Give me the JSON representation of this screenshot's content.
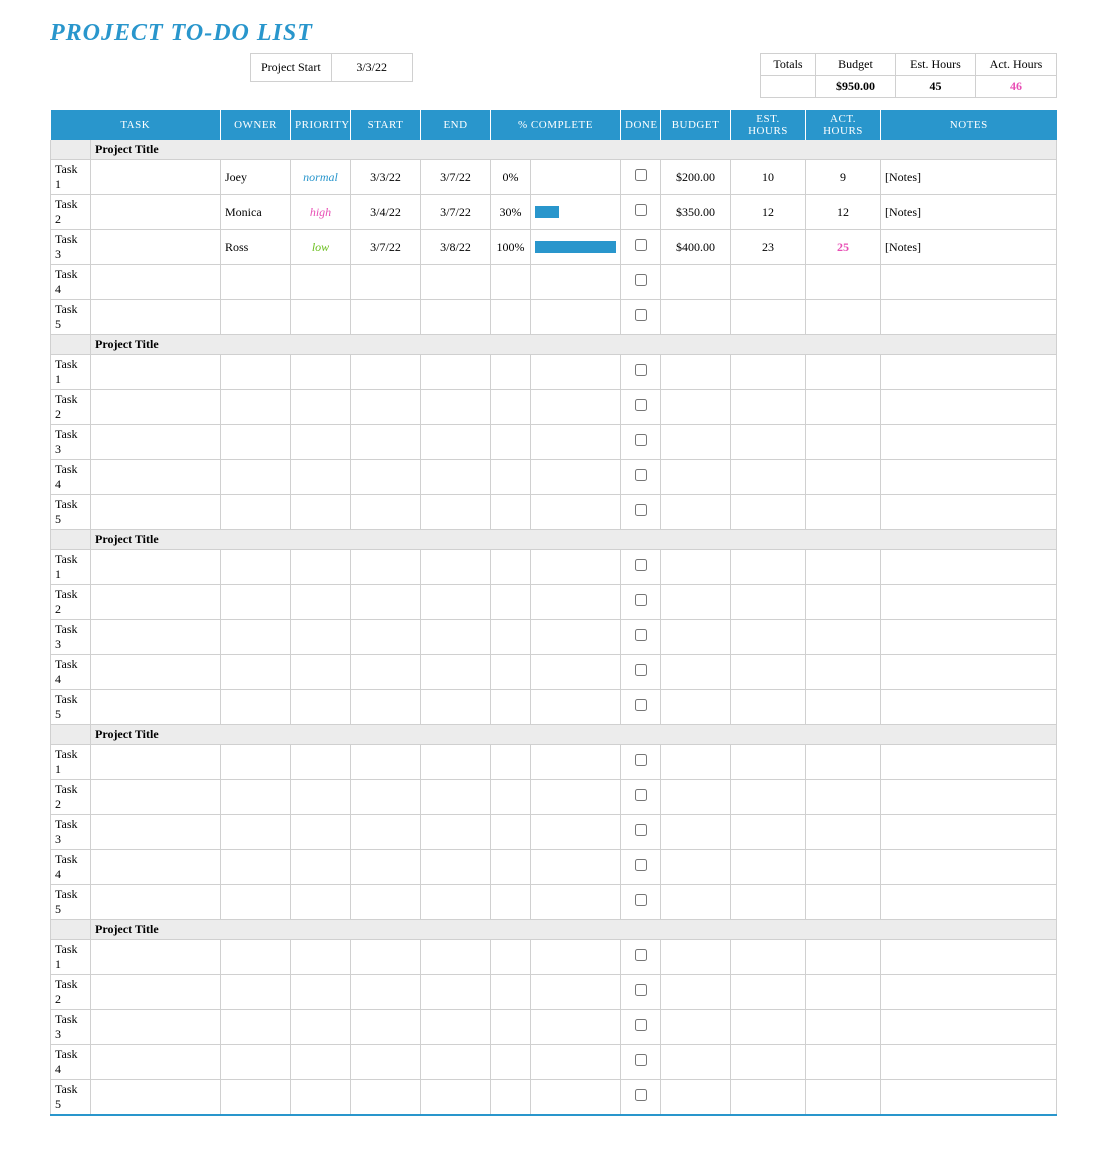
{
  "page": {
    "title": "PROJECT TO-DO LIST"
  },
  "project_start": {
    "label": "Project Start",
    "value": "3/3/22"
  },
  "totals": {
    "row_label": "Totals",
    "budget_label": "Budget",
    "budget_value": "$950.00",
    "esthrs_label": "Est. Hours",
    "esthrs_value": "45",
    "acthrs_label": "Act. Hours",
    "acthrs_value": "46"
  },
  "columns": {
    "task": "TASK",
    "owner": "OWNER",
    "priority": "PRIORITY",
    "start": "START",
    "end": "END",
    "pct": "% COMPLETE",
    "done": "DONE",
    "budget": "BUDGET",
    "esthrs": "EST. HOURS",
    "acthrs": "ACT. HOURS",
    "notes": "NOTES"
  },
  "sections": [
    {
      "title": "Project Title",
      "rows": [
        {
          "task": "Task 1",
          "owner": "Joey",
          "priority": "normal",
          "start": "3/3/22",
          "end": "3/7/22",
          "pct": "0%",
          "pct_num": 0,
          "done": false,
          "budget": "$200.00",
          "est": "10",
          "act": "9",
          "act_exceed": false,
          "notes": "[Notes]"
        },
        {
          "task": "Task 2",
          "owner": "Monica",
          "priority": "high",
          "start": "3/4/22",
          "end": "3/7/22",
          "pct": "30%",
          "pct_num": 30,
          "done": false,
          "budget": "$350.00",
          "est": "12",
          "act": "12",
          "act_exceed": false,
          "notes": "[Notes]"
        },
        {
          "task": "Task 3",
          "owner": "Ross",
          "priority": "low",
          "start": "3/7/22",
          "end": "3/8/22",
          "pct": "100%",
          "pct_num": 100,
          "done": false,
          "budget": "$400.00",
          "est": "23",
          "act": "25",
          "act_exceed": true,
          "notes": "[Notes]"
        },
        {
          "task": "Task 4"
        },
        {
          "task": "Task 5"
        }
      ]
    },
    {
      "title": "Project Title",
      "rows": [
        {
          "task": "Task 1"
        },
        {
          "task": "Task 2"
        },
        {
          "task": "Task 3"
        },
        {
          "task": "Task 4"
        },
        {
          "task": "Task 5"
        }
      ]
    },
    {
      "title": "Project Title",
      "rows": [
        {
          "task": "Task 1"
        },
        {
          "task": "Task 2"
        },
        {
          "task": "Task 3"
        },
        {
          "task": "Task 4"
        },
        {
          "task": "Task 5"
        }
      ]
    },
    {
      "title": "Project Title",
      "rows": [
        {
          "task": "Task 1"
        },
        {
          "task": "Task 2"
        },
        {
          "task": "Task 3"
        },
        {
          "task": "Task 4"
        },
        {
          "task": "Task 5"
        }
      ]
    },
    {
      "title": "Project Title",
      "rows": [
        {
          "task": "Task 1"
        },
        {
          "task": "Task 2"
        },
        {
          "task": "Task 3"
        },
        {
          "task": "Task 4"
        },
        {
          "task": "Task 5"
        }
      ]
    }
  ]
}
